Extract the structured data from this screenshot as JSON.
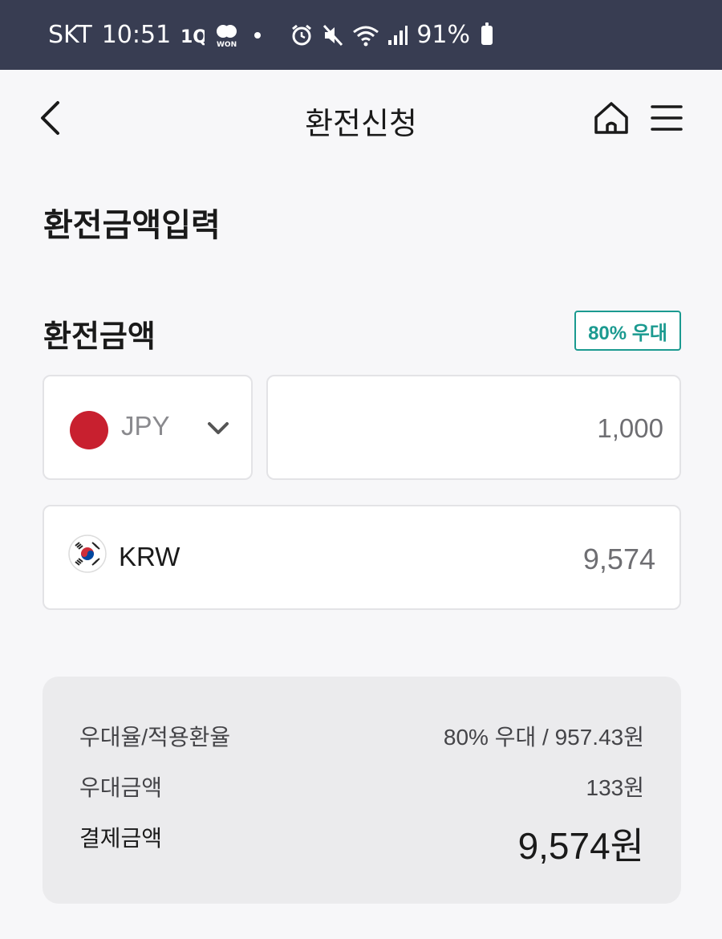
{
  "status_bar": {
    "carrier": "SKT",
    "time": "10:51",
    "battery": "91%",
    "icons": [
      "1q-icon",
      "won-icon",
      "alarm-icon",
      "mute-icon",
      "wifi-icon",
      "signal-icon",
      "battery-icon"
    ],
    "won_label": "WON"
  },
  "header": {
    "title": "환전신청"
  },
  "page": {
    "section_heading": "환전금액입력",
    "amount_label": "환전금액",
    "preference_badge": "80% 우대"
  },
  "exchange": {
    "from_currency": "JPY",
    "from_amount": "1,000",
    "to_currency": "KRW",
    "to_amount": "9,574"
  },
  "summary": {
    "rate_label": "우대율/적용환율",
    "rate_value": "80% 우대 / 957.43원",
    "discount_label": "우대금액",
    "discount_value": "133원",
    "total_label": "결제금액",
    "total_value": "9,574원"
  },
  "colors": {
    "status_bar_bg": "#383d52",
    "accent_teal": "#1b9a90",
    "jp_red": "#c8202f",
    "page_bg": "#f7f7f9"
  }
}
